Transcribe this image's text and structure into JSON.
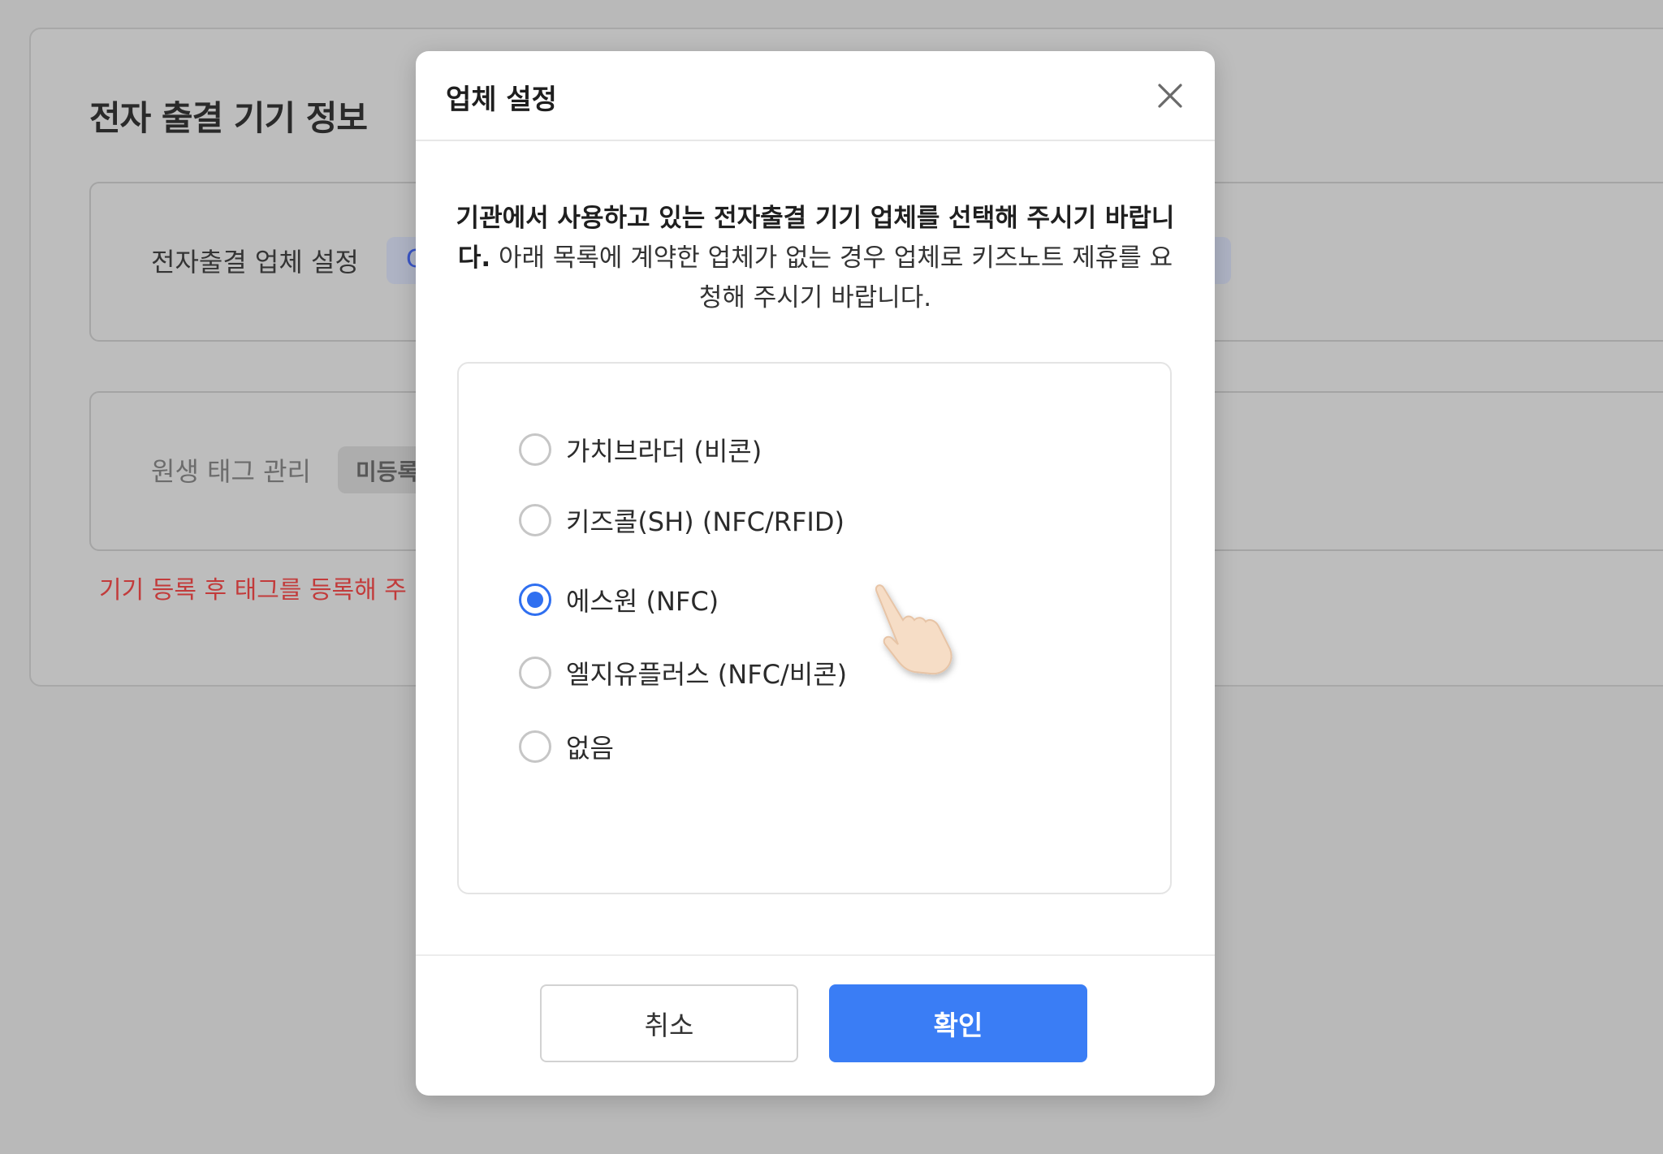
{
  "background": {
    "section_title": "전자 출결 기기 정보",
    "vendor_label": "전자출결 업체 설정",
    "vendor_chip": "C",
    "tag_label": "원생 태그 관리",
    "tag_chip": "미등록",
    "warning": "기기 등록 후 태그를 등록해 주"
  },
  "modal": {
    "title": "업체 설정",
    "close_icon": "close-icon",
    "description_bold": "기관에서 사용하고 있는 전자출결 기기 업체를 선택해 주시기 바랍니다.",
    "description_rest": " 아래 목록에 계약한 업체가 없는 경우 업체로 키즈노트 제휴를 요청해 주시기 바랍니다.",
    "options": [
      {
        "label": "가치브라더 (비콘)",
        "checked": false
      },
      {
        "label": "키즈콜(SH) (NFC/RFID)",
        "checked": false
      },
      {
        "label": "에스원 (NFC)",
        "checked": true
      },
      {
        "label": "엘지유플러스 (NFC/비콘)",
        "checked": false
      },
      {
        "label": "없음",
        "checked": false
      }
    ],
    "cancel_label": "취소",
    "confirm_label": "확인",
    "accent_color": "#3a7df5"
  }
}
